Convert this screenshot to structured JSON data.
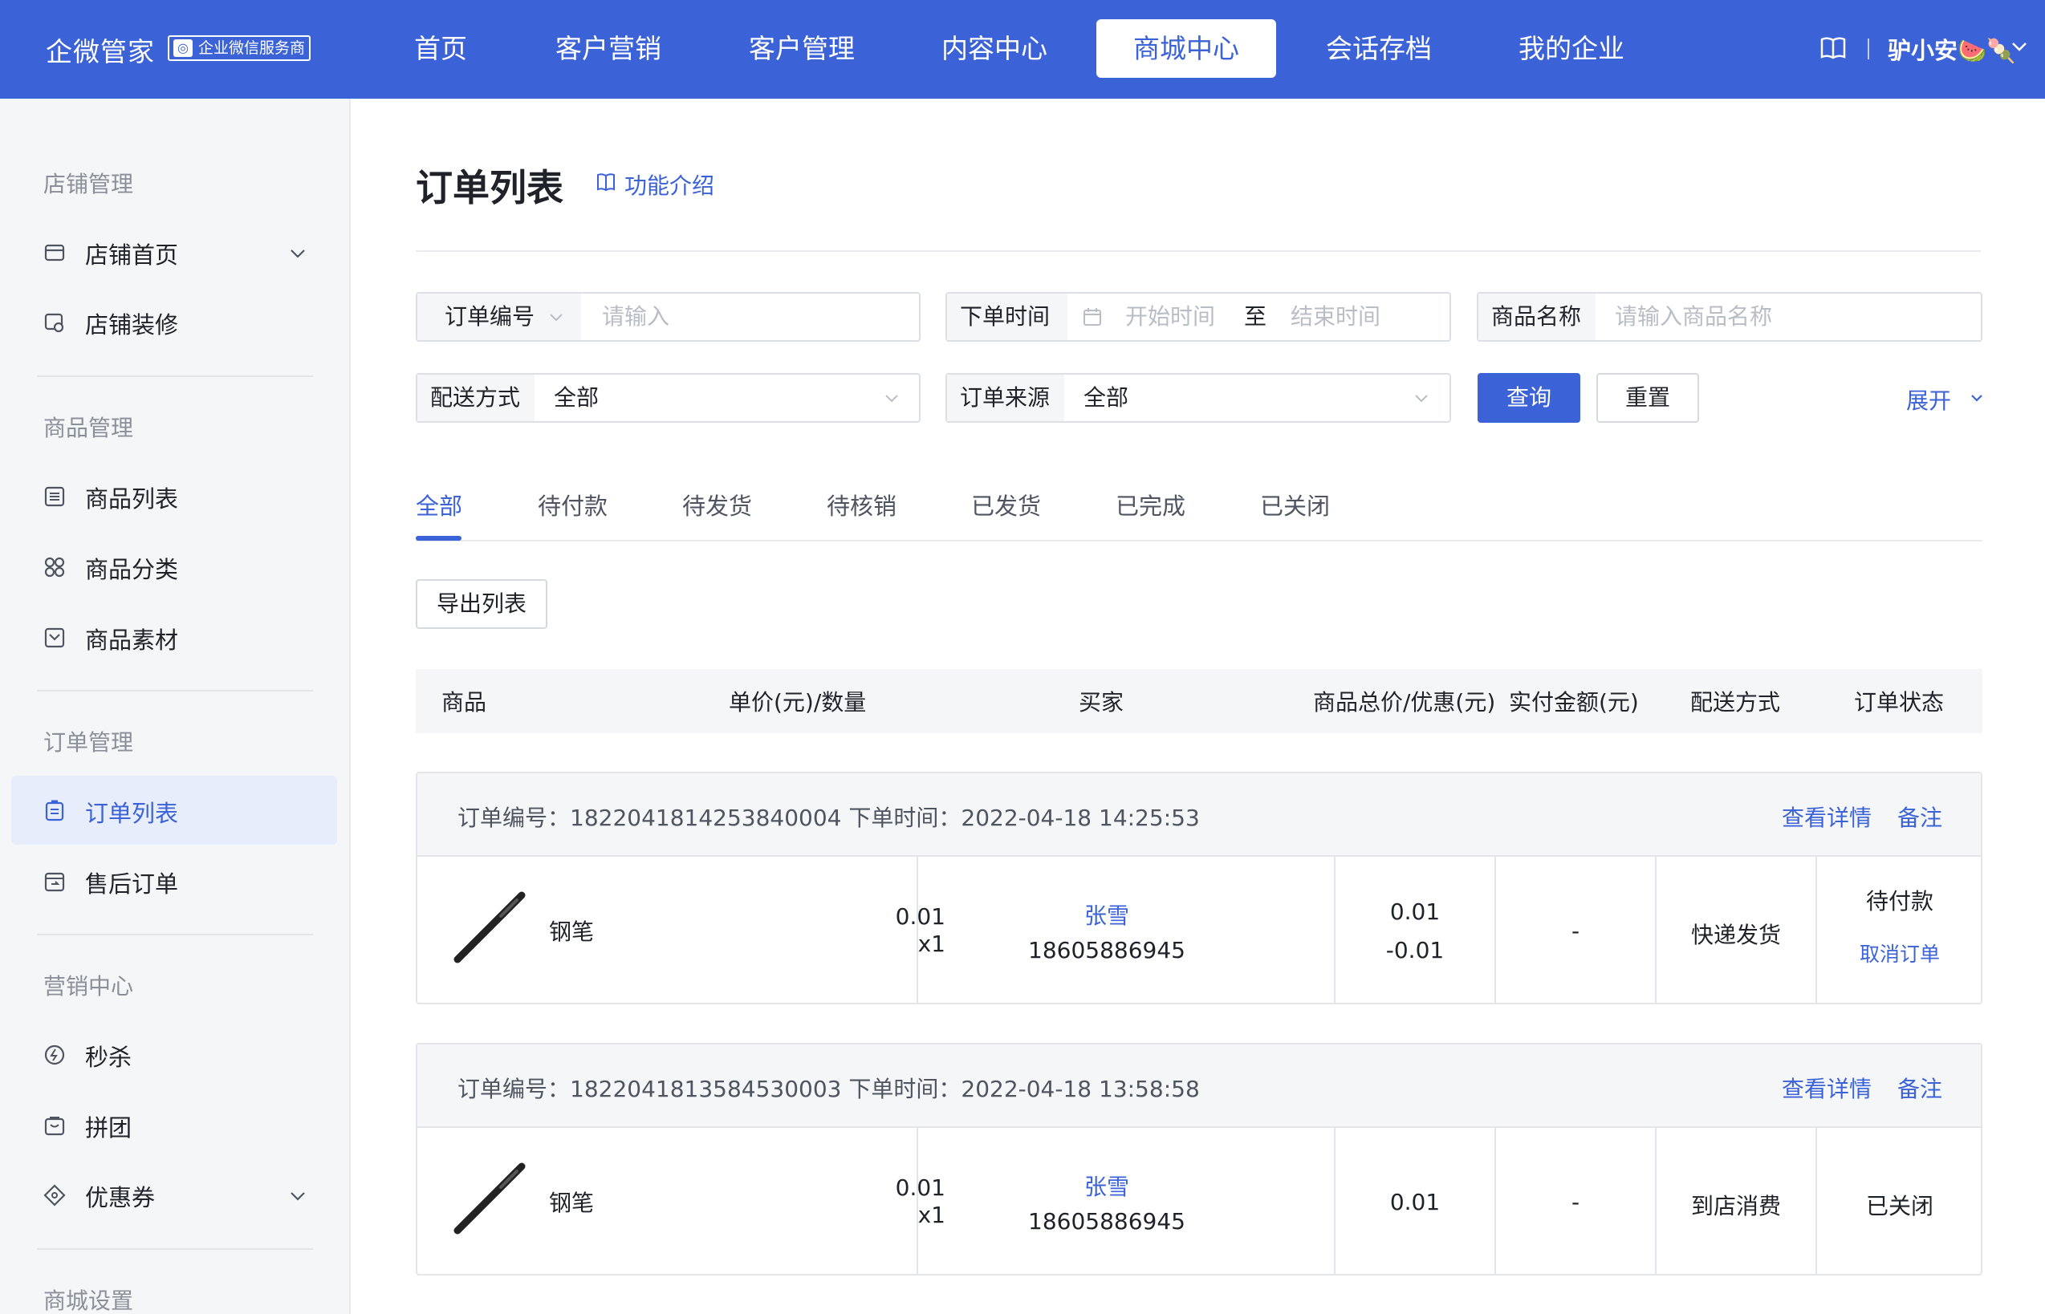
{
  "topbar": {
    "brand": "企微管家",
    "badge": "企业微信服务商",
    "nav": [
      "首页",
      "客户营销",
      "客户管理",
      "内容中心",
      "商城中心",
      "会话存档",
      "我的企业"
    ],
    "active_nav": "商城中心",
    "user": "驴小安🍉🍡"
  },
  "sidebar": {
    "groups": [
      "店铺管理",
      "商品管理",
      "订单管理",
      "营销中心",
      "商城设置"
    ],
    "items": [
      {
        "label": "店铺首页",
        "icon": "store-icon"
      },
      {
        "label": "店铺装修",
        "icon": "decorate-icon"
      },
      {
        "label": "商品列表",
        "icon": "list-icon"
      },
      {
        "label": "商品分类",
        "icon": "category-icon"
      },
      {
        "label": "商品素材",
        "icon": "material-icon"
      },
      {
        "label": "订单列表",
        "icon": "order-icon"
      },
      {
        "label": "售后订单",
        "icon": "after-sale-icon"
      },
      {
        "label": "秒杀",
        "icon": "flash-sale-icon"
      },
      {
        "label": "拼团",
        "icon": "group-buy-icon"
      },
      {
        "label": "优惠券",
        "icon": "coupon-icon"
      }
    ],
    "active_item": "订单列表"
  },
  "main": {
    "title": "订单列表",
    "intro": "功能介绍",
    "filters": {
      "order_no_label": "订单编号",
      "order_no_placeholder": "请输入",
      "time_label": "下单时间",
      "start_placeholder": "开始时间",
      "to": "至",
      "end_placeholder": "结束时间",
      "product_label": "商品名称",
      "product_placeholder": "请输入商品名称",
      "delivery_label": "配送方式",
      "delivery_value": "全部",
      "source_label": "订单来源",
      "source_value": "全部",
      "query": "查询",
      "reset": "重置",
      "expand": "展开"
    },
    "tabs": [
      "全部",
      "待付款",
      "待发货",
      "待核销",
      "已发货",
      "已完成",
      "已关闭"
    ],
    "active_tab": "全部",
    "export": "导出列表",
    "columns": [
      "商品",
      "单价(元)/数量",
      "买家",
      "商品总价/优惠(元)",
      "实付金额(元)",
      "配送方式",
      "订单状态"
    ],
    "orders": [
      {
        "info": "订单编号：1822041814253840004   下单时间：2022-04-18 14:25:53",
        "detail": "查看详情",
        "note": "备注",
        "product": "钢笔",
        "price": "0.01",
        "qty": "x1",
        "buyer": "张雪",
        "phone": "18605886945",
        "total": "0.01",
        "discount": "-0.01",
        "paid": "-",
        "delivery": "快递发货",
        "status": "待付款",
        "action": "取消订单"
      },
      {
        "info": "订单编号：1822041813584530003   下单时间：2022-04-18 13:58:58",
        "detail": "查看详情",
        "note": "备注",
        "product": "钢笔",
        "price": "0.01",
        "qty": "x1",
        "buyer": "张雪",
        "phone": "18605886945",
        "total": "0.01",
        "paid": "-",
        "delivery": "到店消费",
        "status": "已关闭"
      }
    ]
  },
  "colors": {
    "primary": "#3b62d6",
    "sidebar_bg": "#f5f6f8"
  }
}
